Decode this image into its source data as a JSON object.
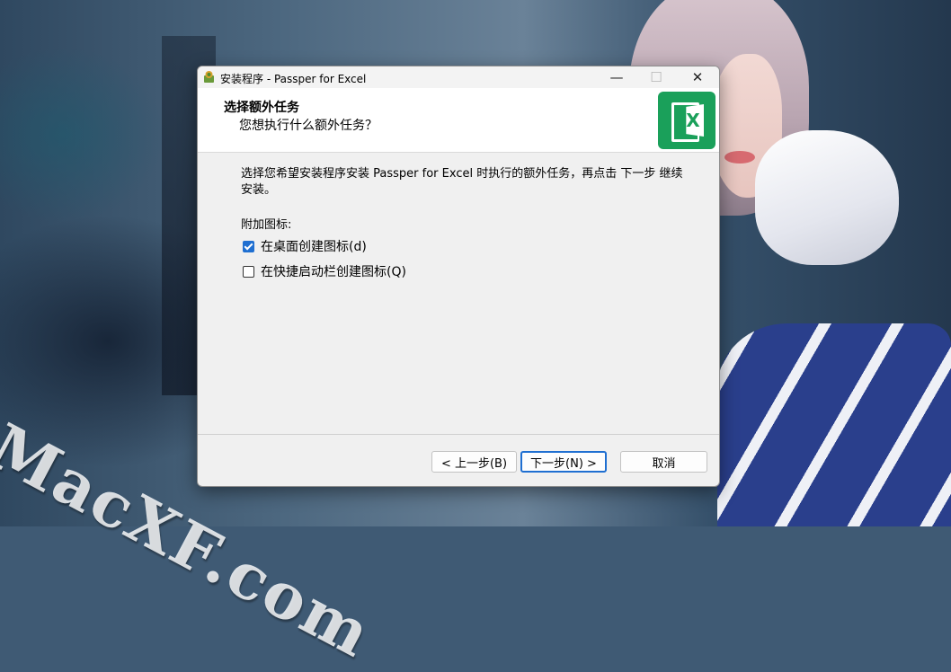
{
  "window": {
    "title": "安装程序 - Passper for Excel",
    "controls": {
      "minimize": "—",
      "maximize": "☐",
      "close": "✕"
    }
  },
  "header": {
    "title": "选择额外任务",
    "subtitle": "您想执行什么额外任务？",
    "logo_icon": "excel-x-icon",
    "logo_letter": "X",
    "logo_color": "#1aa05a"
  },
  "body": {
    "description": "选择您希望安装程序安装 Passper for Excel 时执行的额外任务，再点击 下一步 继续安装。",
    "section_label": "附加图标:",
    "options": [
      {
        "label": "在桌面创建图标(d)",
        "checked": true
      },
      {
        "label": "在快捷启动栏创建图标(Q)",
        "checked": false
      }
    ]
  },
  "footer": {
    "back_label": "< 上一步(B)",
    "next_label": "下一步(N) >",
    "cancel_label": "取消"
  },
  "desktop": {
    "watermark": "MacXF.com"
  },
  "colors": {
    "accent": "#1f6fd1",
    "window_bg": "#f0f0f0",
    "header_bg": "#ffffff"
  }
}
